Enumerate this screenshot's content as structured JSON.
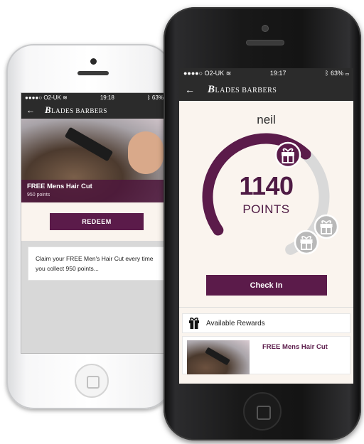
{
  "colors": {
    "brand_purple": "#5b1b4a",
    "text_purple": "#4e1a44",
    "ring_grey": "#d9d9d9",
    "nav_dark": "#2b2b2b",
    "background_cream": "#faf4ee"
  },
  "app": {
    "logo_initial": "B",
    "logo_text": "LADES BARBERS"
  },
  "phone_white": {
    "status": {
      "carrier": "●●●●○ O2-UK ",
      "wifi": "wifi-icon",
      "time": "19:18",
      "battery": "63%"
    },
    "back_label": "←",
    "reward": {
      "title": "FREE Mens Hair Cut",
      "points": "950 points"
    },
    "redeem_label": "REDEEM",
    "description": "Claim your FREE Men's Hair Cut every time you collect 950 points..."
  },
  "phone_black": {
    "status": {
      "carrier": "●●●●○ O2-UK ",
      "wifi": "wifi-icon",
      "time": "19:17",
      "battery": "63%"
    },
    "back_label": "←",
    "username": "neil",
    "points_value": "1140",
    "points_label": "POINTS",
    "progress_fraction": 0.6,
    "checkin_label": "Check In",
    "rewards_header": "Available Rewards",
    "rewards": [
      {
        "title": "FREE Mens Hair Cut"
      }
    ],
    "icons": [
      "gift-icon",
      "gift-icon",
      "gift-icon",
      "gift-icon"
    ]
  }
}
